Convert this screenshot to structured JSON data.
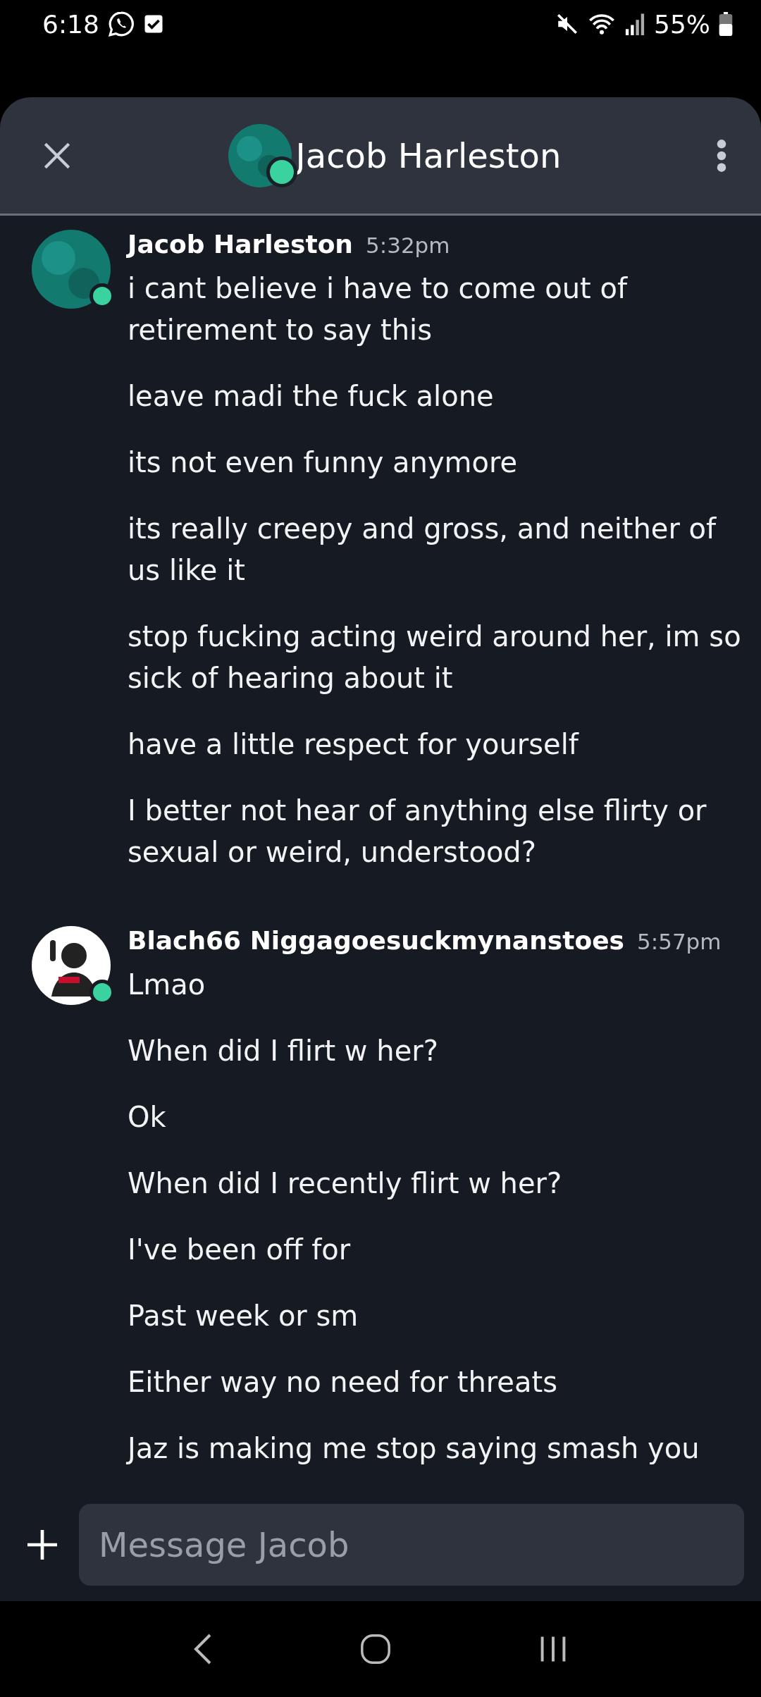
{
  "status_bar": {
    "time": "6:18",
    "battery": "55%"
  },
  "header": {
    "title": "Jacob Harleston",
    "online": true
  },
  "groups": [
    {
      "author": "Jacob Harleston",
      "time": "5:32pm",
      "online": true,
      "kind": "teal",
      "messages": [
        "i cant believe i have to come out of retirement to say this",
        "leave madi the fuck alone",
        "its not even funny anymore",
        "its really creepy and gross, and neither of us like it",
        "stop fucking acting weird around her, im so sick of hearing about it",
        "have a little respect for yourself",
        "I better not hear of anything else flirty or sexual or weird, understood?"
      ]
    },
    {
      "author": "Blach66 Niggagoesuckmynanstoes",
      "time": "5:57pm",
      "online": true,
      "kind": "figure",
      "messages": [
        "Lmao",
        "When did I flirt w her?",
        "Ok",
        "When did I recently flirt w her?",
        "I've been off for",
        "Past week or sm",
        "Either way no need for threats",
        "Jaz is making me stop saying smash you"
      ]
    }
  ],
  "composer": {
    "placeholder": "Message Jacob"
  }
}
